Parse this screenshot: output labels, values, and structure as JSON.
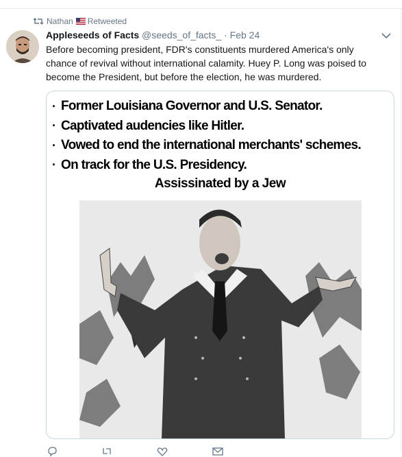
{
  "retweet": {
    "user": "Nathan",
    "action": "Retweeted",
    "flag_icon": "us-flag-icon"
  },
  "tweet": {
    "display_name": "Appleseeds of Facts",
    "handle": "@seeds_of_facts_",
    "separator": "·",
    "date": "Feb 24",
    "text": "Before becoming president, FDR's constituents murdered America's only chance of revival without international calamity. Huey P. Long was poised to become the President, but before the election, he was murdered."
  },
  "media": {
    "bullet_char": "·",
    "bullets": [
      "Former Louisiana Governor and U.S. Senator.",
      "Captivated audencies like Hitler.",
      "Vowed to end the international merchants' schemes.",
      "On track for the U.S. Presidency."
    ],
    "caption": "Assissinated by a Jew",
    "photo_desc_icon": "speaker-photo"
  },
  "icons": {
    "retweet": "retweet-icon",
    "caret": "chevron-down-icon",
    "reply": "reply-icon",
    "like": "heart-icon",
    "dm": "envelope-icon"
  },
  "colors": {
    "text": "#14171a",
    "secondary": "#657786",
    "border": "#ccd6dd"
  }
}
